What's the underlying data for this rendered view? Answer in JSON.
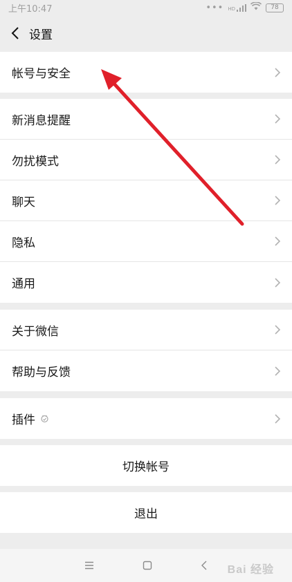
{
  "status_bar": {
    "time": "上午10:47",
    "signal_label": "HD",
    "battery": "78"
  },
  "header": {
    "title": "设置"
  },
  "groups": [
    {
      "items": [
        {
          "label": "帐号与安全"
        }
      ]
    },
    {
      "items": [
        {
          "label": "新消息提醒"
        },
        {
          "label": "勿扰模式"
        },
        {
          "label": "聊天"
        },
        {
          "label": "隐私"
        },
        {
          "label": "通用"
        }
      ]
    },
    {
      "items": [
        {
          "label": "关于微信"
        },
        {
          "label": "帮助与反馈"
        }
      ]
    },
    {
      "items": [
        {
          "label": "插件"
        }
      ]
    }
  ],
  "actions": {
    "switch_account": "切换帐号",
    "logout": "退出"
  },
  "watermark": "Bai 经验",
  "colors": {
    "arrow": "#e0202a",
    "background": "#ededed"
  }
}
